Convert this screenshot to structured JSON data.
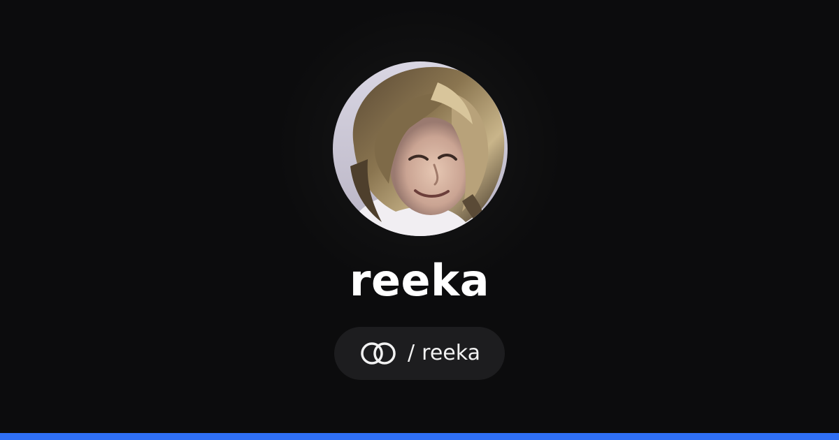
{
  "profile": {
    "display_name": "reeka",
    "avatar_alt": "reeka"
  },
  "handle": {
    "separator": "/",
    "username": "reeka",
    "icon": "linked-rings-icon"
  },
  "colors": {
    "background": "#0c0c0d",
    "pill_background": "#1d1d1f",
    "accent_bar": "#2f6ff5",
    "text": "#ffffff"
  }
}
